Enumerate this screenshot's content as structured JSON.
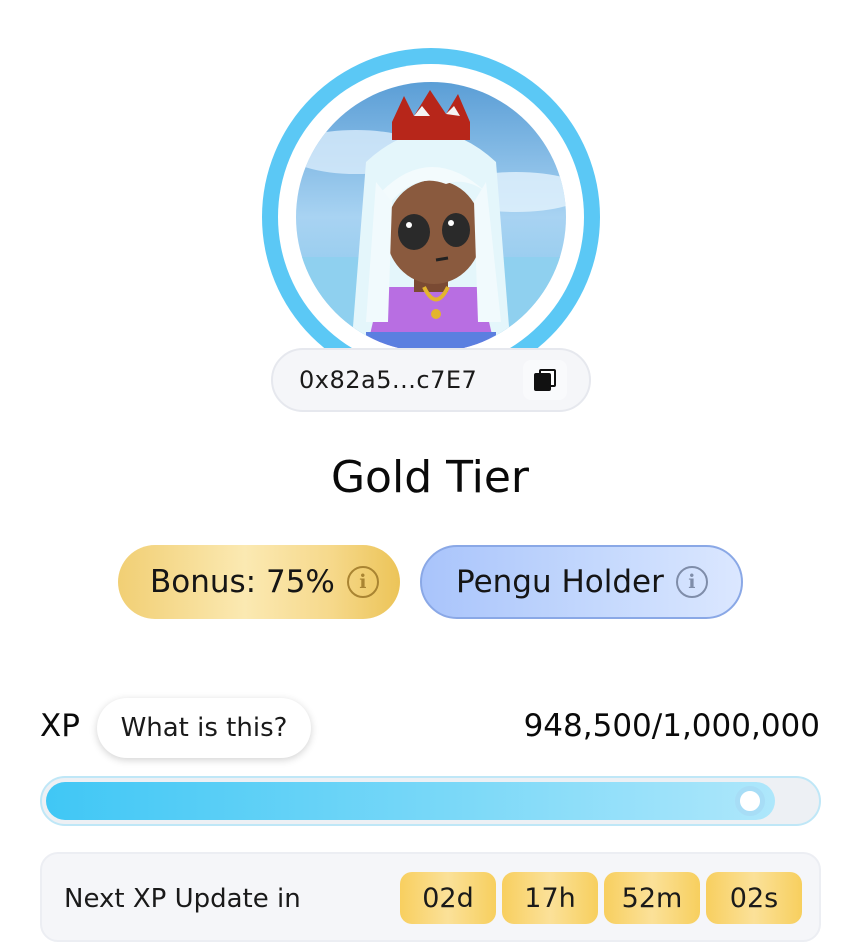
{
  "profile": {
    "avatar_alt": "avatar-image",
    "address": "0x82a5...c7E7",
    "tier": "Gold Tier"
  },
  "badges": {
    "bonus_label": "Bonus: 75%",
    "holder_label": "Pengu Holder"
  },
  "xp": {
    "label": "XP",
    "help_label": "What is this?",
    "value_text": "948,500/1,000,000",
    "progress_fraction": 0.9485
  },
  "next_update": {
    "label": "Next XP Update in",
    "days": "02d",
    "hours": "17h",
    "minutes": "52m",
    "seconds": "02s"
  },
  "colors": {
    "ring": "#5bc8f5",
    "progress": "#40c7f5",
    "gold": "#f1cf74",
    "holder": "#a9c4fb"
  }
}
